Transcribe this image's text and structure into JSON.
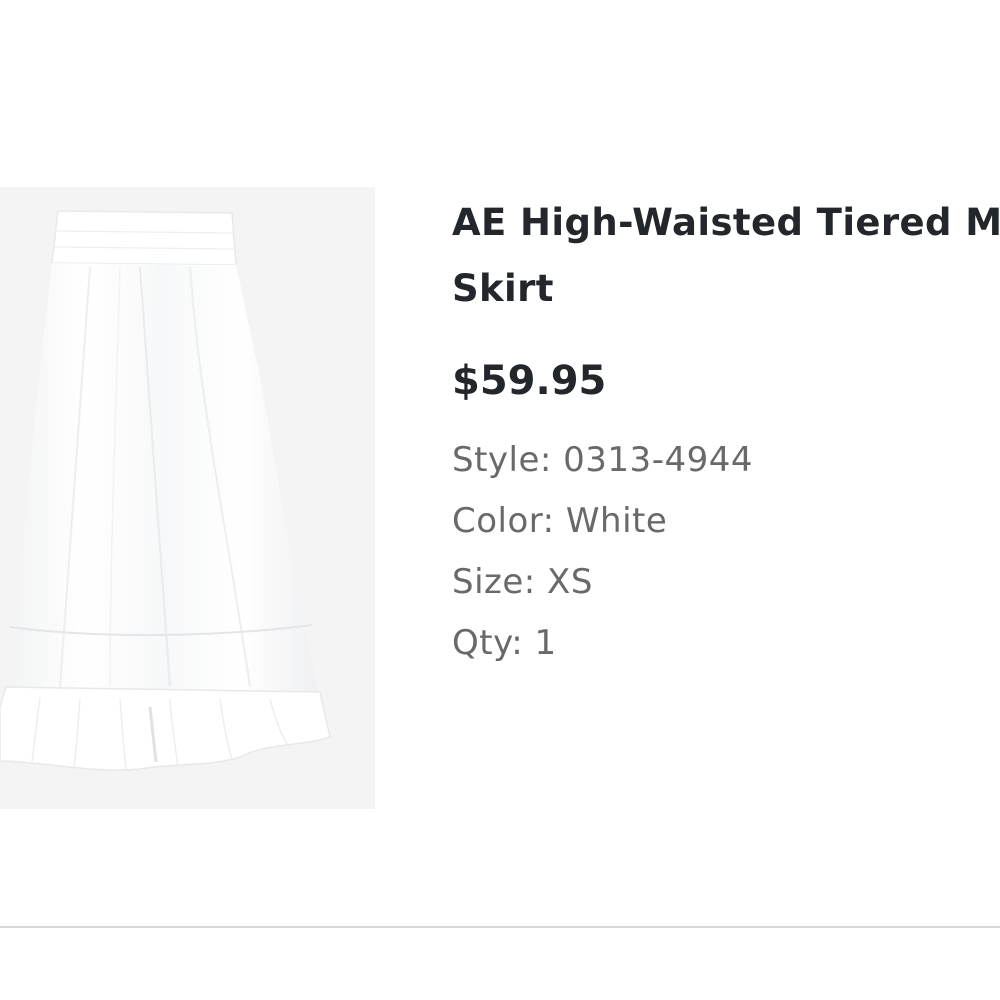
{
  "product": {
    "image_icon": "white-tiered-maxi-skirt-photo",
    "title": "AE High-Waisted Tiered Maxi Skirt",
    "price": "$59.95",
    "details": {
      "style": "Style: 0313-4944",
      "color": "Color: White",
      "size": "Size: XS",
      "qty": "Qty: 1"
    }
  },
  "colors": {
    "title_text": "#23272b",
    "detail_text": "#67696b",
    "image_background": "#f4f4f5",
    "divider": "#d6d7d8"
  }
}
